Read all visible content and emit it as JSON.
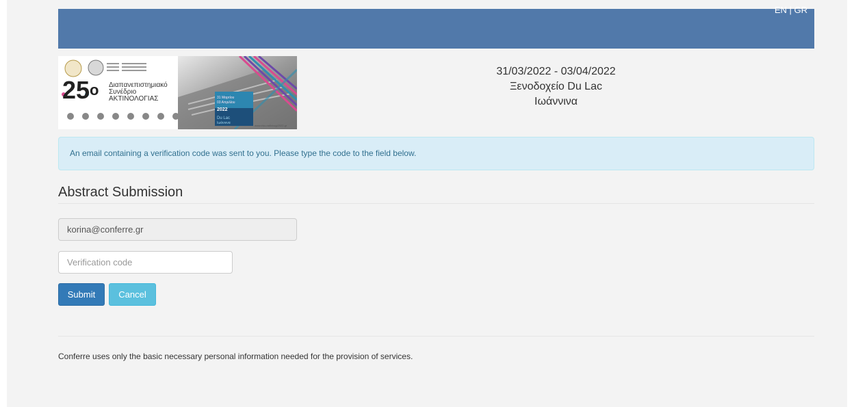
{
  "header": {
    "lang_label": "EN | GR"
  },
  "banner": {
    "number": "25",
    "degree": "ο",
    "line1": "Διαπανεπιστημιακό",
    "line2": "Συνέδριο",
    "line3": "ΑΚΤΙΝΟΛΟΓΙΑΣ",
    "date_line1": "31 Μαρτίου",
    "date_line2": "03 Απριλίου",
    "year": "2022",
    "place1": "Du Lac",
    "place2": "Ιωάννινα",
    "url": "www.eko-radiology2022.gr"
  },
  "venue": {
    "dates": "31/03/2022 - 03/04/2022",
    "hotel": "Ξενοδοχείο Du Lac",
    "city": "Ιωάννινα"
  },
  "alert": {
    "message": "An email containing a verification code was sent to you. Please type the code to the field below."
  },
  "form": {
    "title": "Abstract Submission",
    "email_value": "korina@conferre.gr",
    "code_placeholder": "Verification code",
    "submit_label": "Submit",
    "cancel_label": "Cancel"
  },
  "footer": {
    "text": "Conferre uses only the basic necessary personal information needed for the provision of services."
  },
  "colors": {
    "topbar": "#5179aa",
    "alert_bg": "#d9edf7",
    "submit": "#337ab7",
    "cancel": "#5bc0de"
  }
}
